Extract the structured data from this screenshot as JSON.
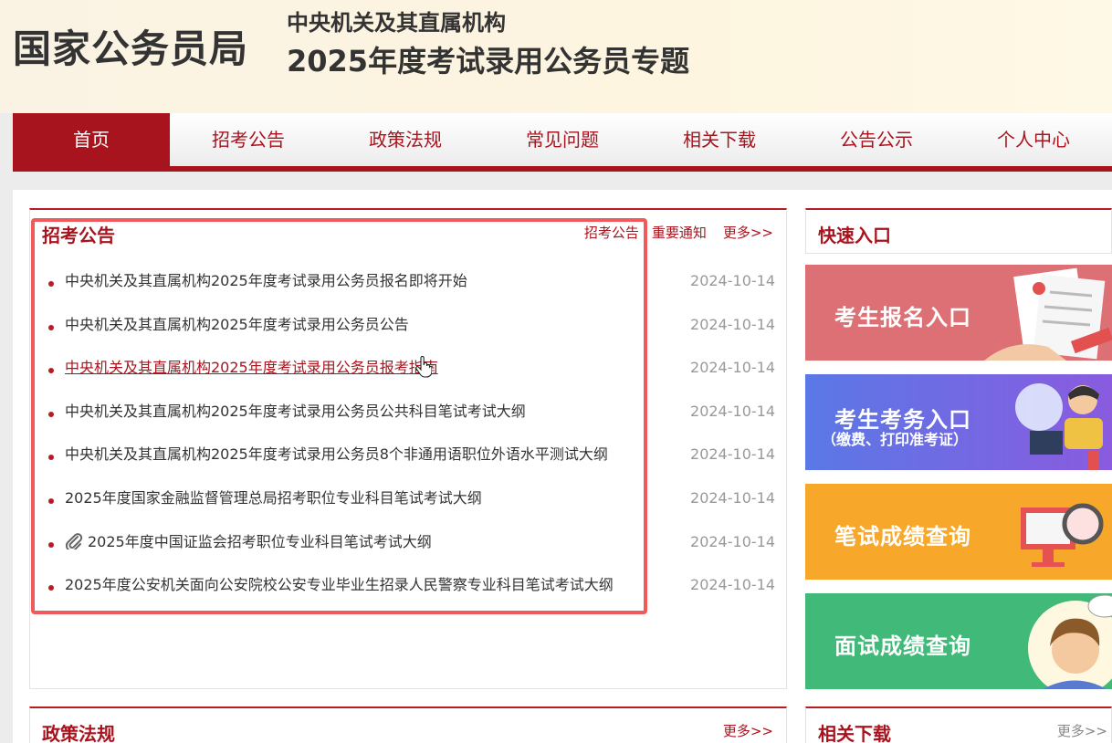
{
  "header": {
    "org": "国家公务员局",
    "subtitle": "中央机关及其直属机构",
    "title": "2025年度考试录用公务员专题"
  },
  "nav": {
    "items": [
      "首页",
      "招考公告",
      "政策法规",
      "常见问题",
      "相关下载",
      "公告公示",
      "个人中心"
    ],
    "active_index": 0
  },
  "announcements": {
    "title": "招考公告",
    "tab_links": [
      "招考公告",
      "重要通知"
    ],
    "more": "更多>>",
    "items": [
      {
        "title": "中央机关及其直属机构2025年度考试录用公务员报名即将开始",
        "date": "2024-10-14"
      },
      {
        "title": "中央机关及其直属机构2025年度考试录用公务员公告",
        "date": "2024-10-14"
      },
      {
        "title": "中央机关及其直属机构2025年度考试录用公务员报考指南",
        "date": "2024-10-14"
      },
      {
        "title": "中央机关及其直属机构2025年度考试录用公务员公共科目笔试考试大纲",
        "date": "2024-10-14"
      },
      {
        "title": "中央机关及其直属机构2025年度考试录用公务员8个非通用语职位外语水平测试大纲",
        "date": "2024-10-14"
      },
      {
        "title": "2025年度国家金融监督管理总局招考职位专业科目笔试考试大纲",
        "date": "2024-10-14"
      },
      {
        "title": "2025年度中国证监会招考职位专业科目笔试考试大纲",
        "date": "2024-10-14"
      },
      {
        "title": "2025年度公安机关面向公安院校公安专业毕业生招录人民警察专业科目笔试考试大纲",
        "date": "2024-10-14"
      }
    ]
  },
  "quick_entry": {
    "title": "快速入口",
    "tiles": [
      {
        "label": "考生报名入口",
        "sublabel": ""
      },
      {
        "label": "考生考务入口",
        "sublabel": "（缴费、打印准考证）"
      },
      {
        "label": "笔试成绩查询",
        "sublabel": ""
      },
      {
        "label": "面试成绩查询",
        "sublabel": ""
      }
    ]
  },
  "policy": {
    "title": "政策法规",
    "more": "更多>>"
  },
  "downloads": {
    "title": "相关下载",
    "more": "更多>>"
  },
  "colors": {
    "brand_red": "#a8141e",
    "highlight": "#f05a5a",
    "tile_pink": "#dd7074",
    "tile_purple": "#6a6ae4",
    "tile_orange": "#f7a72a",
    "tile_green": "#40b979"
  }
}
